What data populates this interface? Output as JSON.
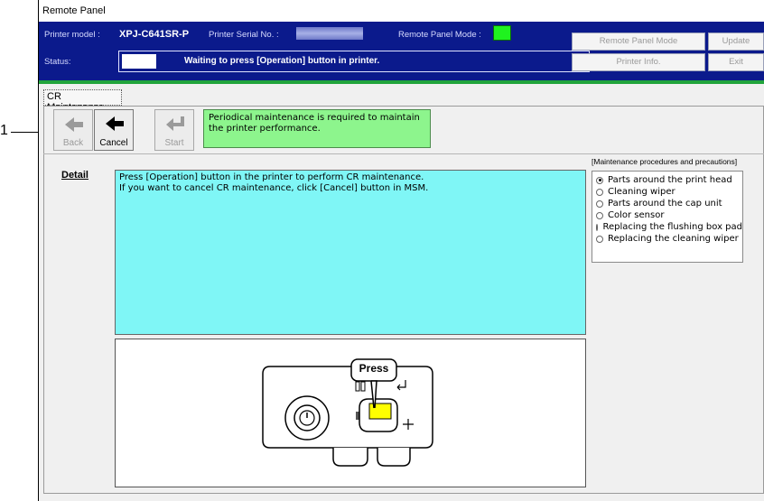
{
  "callout": {
    "number": "1"
  },
  "window": {
    "title": "Remote Panel"
  },
  "header": {
    "printer_model_label": "Printer model :",
    "printer_model_value": "XPJ-C641SR-P",
    "serial_label": "Printer Serial No. :",
    "remote_mode_label": "Remote Panel Mode :",
    "status_label": "Status:",
    "status_message": "Waiting to press [Operation] button in printer.",
    "mode_indicator_color": "#1ff21f"
  },
  "header_buttons": {
    "remote_panel_mode": "Remote Panel Mode",
    "update": "Update",
    "printer_info": "Printer Info.",
    "exit": "Exit"
  },
  "tab": {
    "label": "CR Maintenance"
  },
  "toolbar": {
    "back_label": "Back",
    "cancel_label": "Cancel",
    "start_label": "Start",
    "message": "Periodical maintenance is required to maintain the printer performance."
  },
  "detail": {
    "label": "Detail",
    "lines": [
      "Press [Operation] button in the printer to perform CR maintenance.",
      "If you want to cancel CR maintenance, click [Cancel] button in MSM."
    ]
  },
  "illustration": {
    "press_label": "Press",
    "button_color": "#ffff00"
  },
  "procedures": {
    "header": "[Maintenance procedures and precautions]",
    "items": [
      {
        "label": "Parts around the print head",
        "selected": true
      },
      {
        "label": "Cleaning wiper",
        "selected": false
      },
      {
        "label": "Parts around the cap unit",
        "selected": false
      },
      {
        "label": "Color sensor",
        "selected": false
      },
      {
        "label": "Replacing the flushing box pad",
        "selected": false
      },
      {
        "label": "Replacing the cleaning wiper",
        "selected": false
      }
    ]
  }
}
